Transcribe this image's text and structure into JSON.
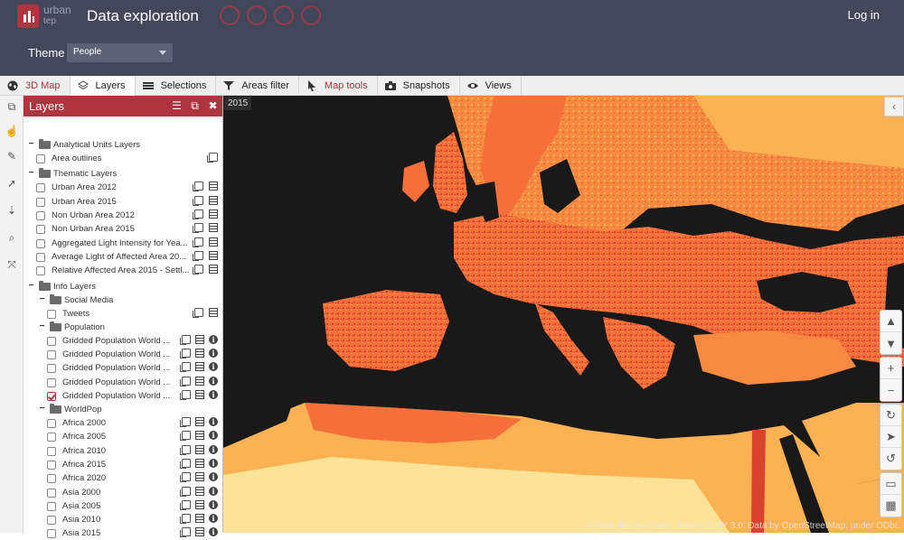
{
  "header": {
    "logo_line1": "urban",
    "logo_line2": "tep",
    "title": "Data exploration",
    "login": "Log in",
    "theme_label": "Theme",
    "theme_value": "People"
  },
  "toolbar": {
    "items": [
      {
        "label": "3D Map",
        "icon": "globe-icon"
      },
      {
        "label": "Layers",
        "icon": "layers-icon"
      },
      {
        "label": "Selections",
        "icon": "list-icon"
      },
      {
        "label": "Areas filter",
        "icon": "funnel-icon"
      },
      {
        "label": "Map tools",
        "icon": "cursor-icon"
      },
      {
        "label": "Snapshots",
        "icon": "camera-icon"
      },
      {
        "label": "Views",
        "icon": "eye-icon"
      }
    ]
  },
  "panel": {
    "title": "Layers",
    "groups": [
      {
        "label": "Analytical Units Layers",
        "items": [
          "Area outlines"
        ]
      },
      {
        "label": "Thematic Layers",
        "items": [
          "Urban Area 2012",
          "Urban Area 2015",
          "Non Urban Area 2012",
          "Non Urban Area 2015",
          "Aggregated Light Intensity for Yea...",
          "Average Light of Affected Area 20...",
          "Relative Affected Area 2015 - Settl..."
        ]
      },
      {
        "label": "Info Layers"
      },
      {
        "label": "Social Media",
        "items": [
          "Tweets"
        ]
      },
      {
        "label": "Population",
        "items": [
          "Gridded Population World ...",
          "Gridded Population World ...",
          "Gridded Population World ...",
          "Gridded Population World ...",
          "Gridded Population World ..."
        ]
      },
      {
        "label": "WorldPop",
        "items": [
          "Africa 2000",
          "Africa 2005",
          "Africa 2010",
          "Africa 2015",
          "Africa 2020",
          "Asia 2000",
          "Asia 2005",
          "Asia 2010",
          "Asia 2015"
        ]
      }
    ]
  },
  "map": {
    "year": "2015",
    "attribution": "© Map tiles by Carto, under CC BY 3.0. Data by OpenStreetMap, under ODbL.",
    "colors": {
      "sea": "#191919",
      "high": "#d8432e",
      "mid": "#f46f3a",
      "low": "#fbb253",
      "vlow": "#fde398"
    }
  }
}
